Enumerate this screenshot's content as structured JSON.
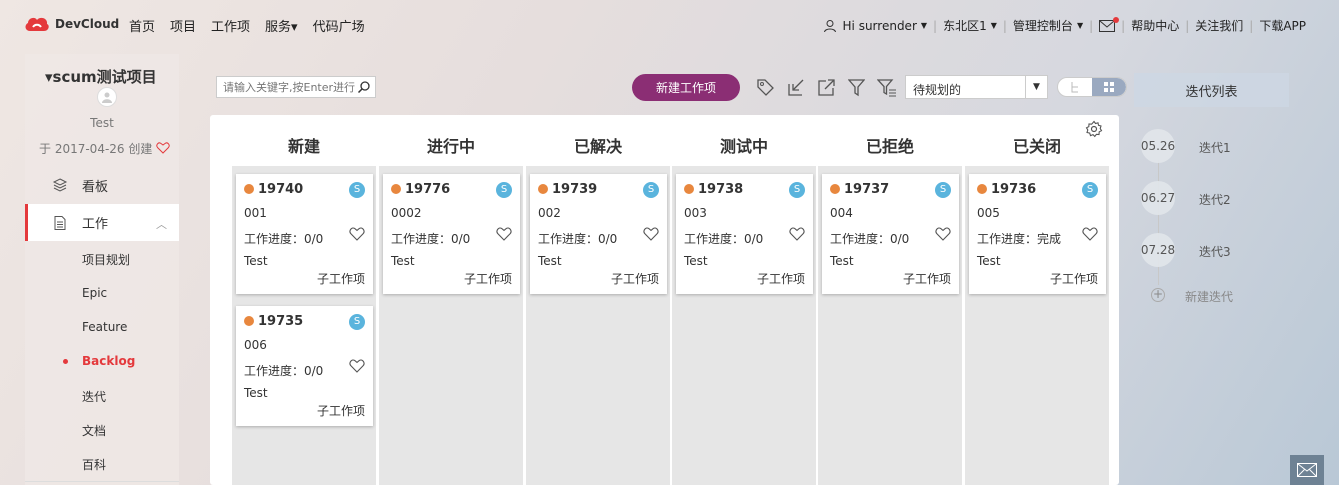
{
  "topbar": {
    "logo_text": "DevCloud",
    "nav": [
      "首页",
      "项目",
      "工作项",
      "服务▾",
      "代码广场"
    ],
    "user_greeting": "Hi surrender",
    "region": "东北区1",
    "console": "管理控制台",
    "help": "帮助中心",
    "follow": "关注我们",
    "download": "下载APP"
  },
  "sidebar": {
    "project_title": "▾scum测试项目",
    "owner": "Test",
    "created": "于 2017-04-26 创建",
    "menu": [
      {
        "label": "看板"
      },
      {
        "label": "工作"
      }
    ],
    "submenu": [
      "项目规划",
      "Epic",
      "Feature",
      "Backlog",
      "迭代",
      "文档",
      "百科"
    ]
  },
  "toolbar": {
    "search_placeholder": "请输入关键字,按Enter进行搜索",
    "new_button": "新建工作项",
    "filter_select": "待规划的"
  },
  "board": {
    "columns": [
      {
        "title": "新建",
        "cards": [
          {
            "id": "19740",
            "badge": "S",
            "name": "001",
            "progress": "工作进度：0/0",
            "owner": "Test",
            "sub": "子工作项"
          },
          {
            "id": "19735",
            "badge": "S",
            "name": "006",
            "progress": "工作进度：0/0",
            "owner": "Test",
            "sub": "子工作项"
          }
        ]
      },
      {
        "title": "进行中",
        "cards": [
          {
            "id": "19776",
            "badge": "S",
            "name": "0002",
            "progress": "工作进度：0/0",
            "owner": "Test",
            "sub": "子工作项"
          }
        ]
      },
      {
        "title": "已解决",
        "cards": [
          {
            "id": "19739",
            "badge": "S",
            "name": "002",
            "progress": "工作进度：0/0",
            "owner": "Test",
            "sub": "子工作项"
          }
        ]
      },
      {
        "title": "测试中",
        "cards": [
          {
            "id": "19738",
            "badge": "S",
            "name": "003",
            "progress": "工作进度：0/0",
            "owner": "Test",
            "sub": "子工作项"
          }
        ]
      },
      {
        "title": "已拒绝",
        "cards": [
          {
            "id": "19737",
            "badge": "S",
            "name": "004",
            "progress": "工作进度：0/0",
            "owner": "Test",
            "sub": "子工作项"
          }
        ]
      },
      {
        "title": "已关闭",
        "cards": [
          {
            "id": "19736",
            "badge": "S",
            "name": "005",
            "progress": "工作进度：完成",
            "owner": "Test",
            "sub": "子工作项"
          }
        ]
      }
    ]
  },
  "iterations": {
    "header": "迭代列表",
    "items": [
      {
        "date": "05.26",
        "name": "迭代1"
      },
      {
        "date": "06.27",
        "name": "迭代2"
      },
      {
        "date": "07.28",
        "name": "迭代3"
      }
    ],
    "new_label": "新建迭代"
  },
  "colors": {
    "accent": "#8b2e74",
    "active_red": "#e4393c",
    "status_dot": "#e8873e",
    "badge_blue": "#5ab4dd"
  }
}
